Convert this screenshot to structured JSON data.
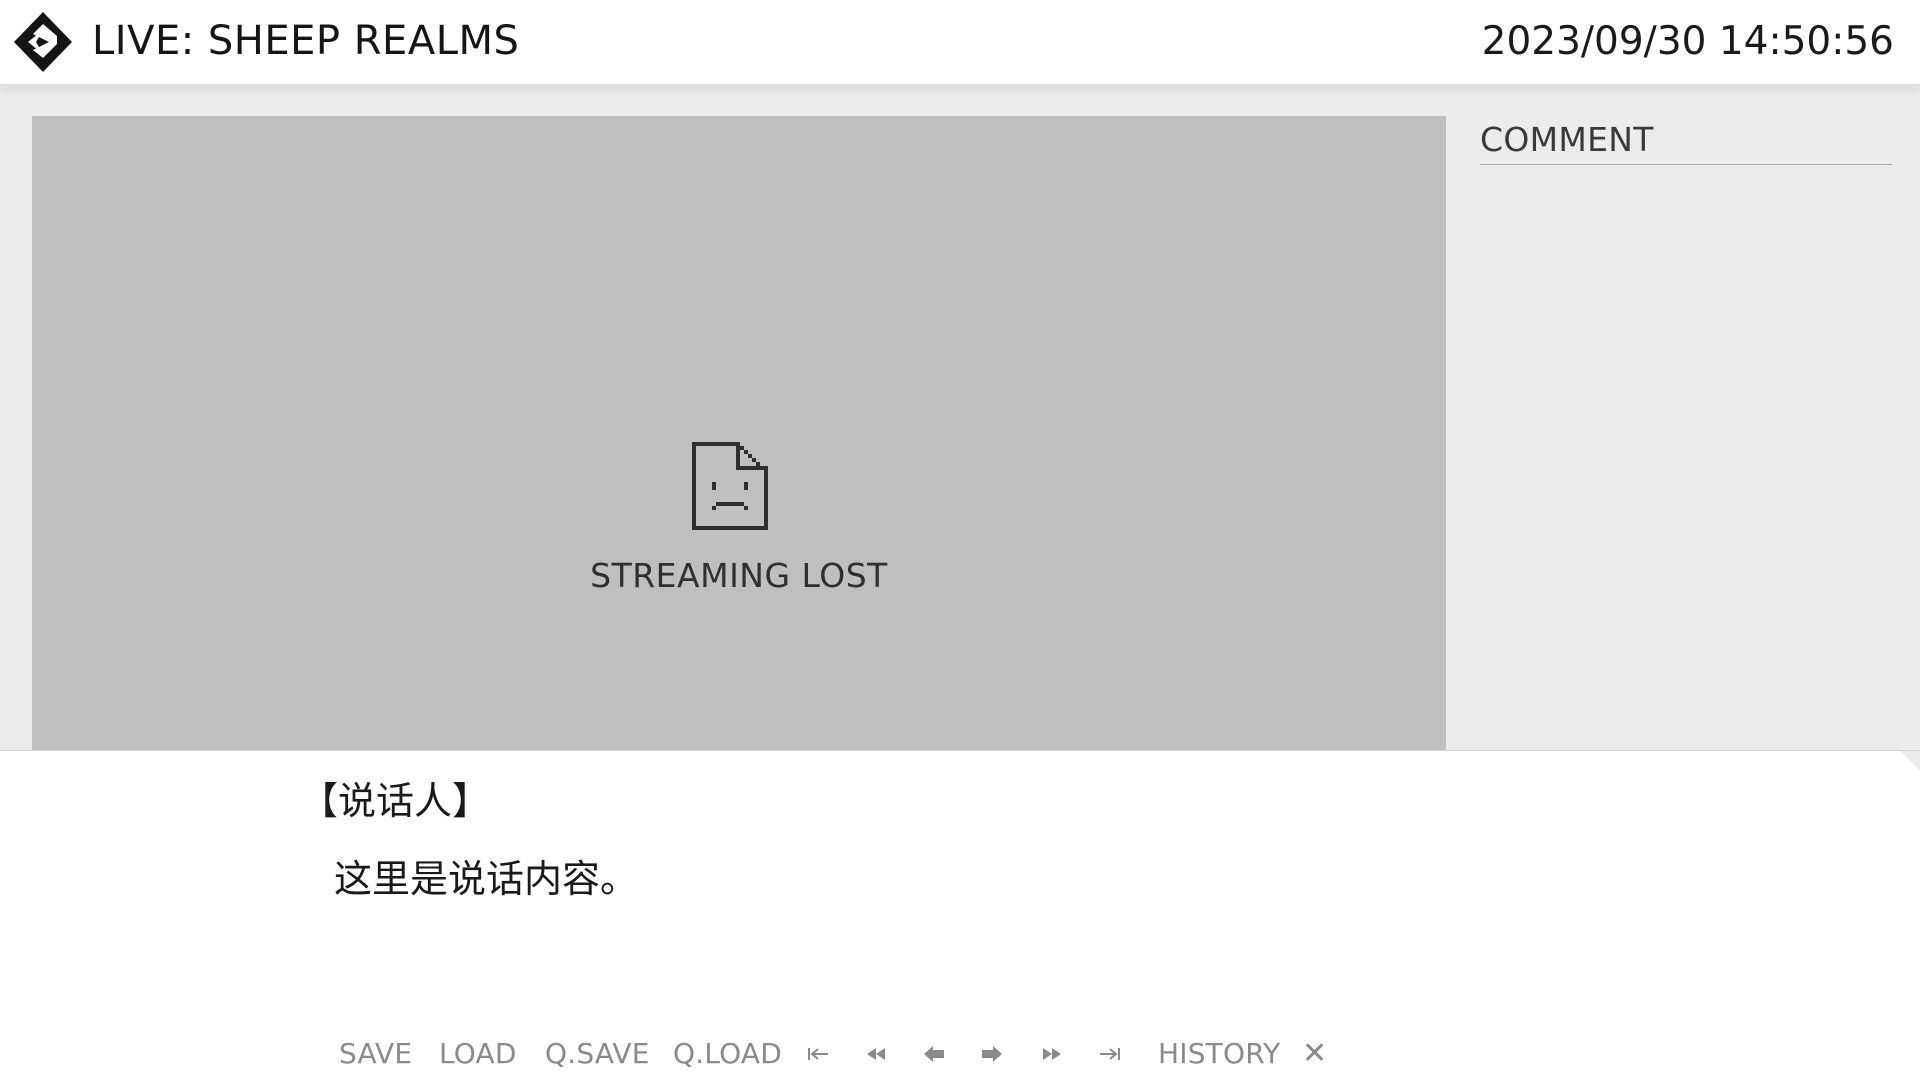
{
  "header": {
    "title": "LIVE: SHEEP REALMS",
    "datetime": "2023/09/30 14:50:56",
    "logo_icon": "diamond-logo-icon"
  },
  "stream": {
    "status_text": "STREAMING LOST",
    "status_icon": "sad-file-icon",
    "background_color": "#bfbfbf"
  },
  "comments": {
    "title": "COMMENT"
  },
  "dialogue": {
    "speaker": "【说话人】",
    "text": "这里是说话内容。"
  },
  "menu": {
    "save": "SAVE",
    "load": "LOAD",
    "qsave": "Q.SAVE",
    "qload": "Q.LOAD",
    "history": "HISTORY",
    "close": "✕",
    "icons": [
      "skip-to-start-icon",
      "fast-rewind-icon",
      "back-arrow-icon",
      "forward-arrow-icon",
      "fast-forward-icon",
      "skip-to-end-icon"
    ],
    "text_color": "#8a8a8a"
  }
}
